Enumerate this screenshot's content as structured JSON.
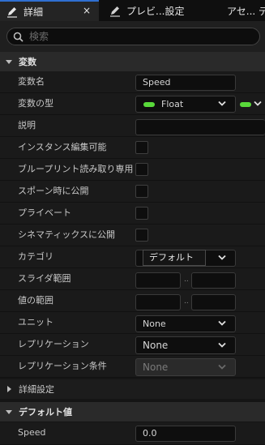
{
  "tabs": [
    {
      "label": "詳細",
      "active": true,
      "close": "×"
    },
    {
      "label": "プレビ...設定",
      "active": false
    },
    {
      "label": "アセ... デ",
      "active": false
    }
  ],
  "search": {
    "placeholder": "検索",
    "value": ""
  },
  "sections": {
    "variables": "変数",
    "defaults": "デフォルト値"
  },
  "rows": {
    "var_name": {
      "label": "変数名",
      "value": "Speed"
    },
    "var_type": {
      "label": "変数の型",
      "value": "Float",
      "pin_color": "#59d93a"
    },
    "description": {
      "label": "説明",
      "value": ""
    },
    "instance_editable": {
      "label": "インスタンス編集可能",
      "checked": false
    },
    "bp_readonly": {
      "label": "ブループリント読み取り専用",
      "checked": false
    },
    "expose_spawn": {
      "label": "スポーン時に公開",
      "checked": false
    },
    "private": {
      "label": "プライベート",
      "checked": false
    },
    "expose_cinematics": {
      "label": "シネマティックスに公開",
      "checked": false
    },
    "category": {
      "label": "カテゴリ",
      "value": "",
      "tooltip": "デフォルト"
    },
    "slider_range": {
      "label": "スライダ範囲",
      "separator": "..",
      "min": "",
      "max": ""
    },
    "value_range": {
      "label": "値の範囲",
      "separator": "..",
      "min": "",
      "max": ""
    },
    "units": {
      "label": "ユニット",
      "value": "None"
    },
    "replication": {
      "label": "レプリケーション",
      "value": "None"
    },
    "replication_condition": {
      "label": "レプリケーション条件",
      "value": "None"
    }
  },
  "advanced": {
    "label": "詳細設定"
  },
  "default_values": [
    {
      "label": "Speed",
      "value": "0.0"
    }
  ],
  "colors": {
    "accent": "#2f6fd1",
    "float_pin": "#59d93a"
  }
}
